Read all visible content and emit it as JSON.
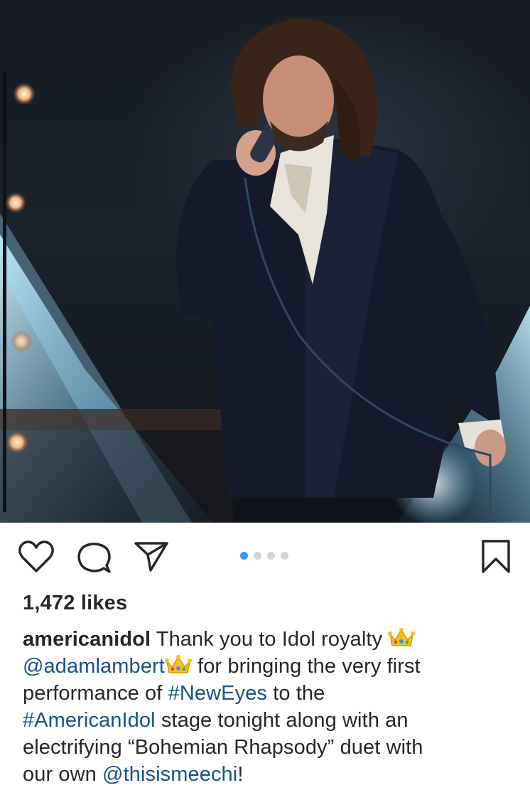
{
  "post": {
    "image_alt": "Performer in dark velvet suit singing into microphone on stage",
    "carousel": {
      "count": 4,
      "active_index": 0
    }
  },
  "actions": {
    "like_icon": "heart-icon",
    "comment_icon": "comment-icon",
    "share_icon": "paper-plane-icon",
    "save_icon": "bookmark-icon"
  },
  "likes": "1,472 likes",
  "caption": {
    "username": "americanidol",
    "line1_text": "Thank you to Idol royalty",
    "mention1": "@adamlambert",
    "line2_text": " for bringing the very first",
    "line3_text": "performance of ",
    "hashtag1": "#NewEyes",
    "line3_end": " to the",
    "hashtag2": "#AmericanIdol",
    "line4_text": " stage tonight along with an",
    "line5_text": "electrifying “Bohemian Rhapsody” duet with",
    "line6_text": "our own ",
    "mention2": "@thisismeechi",
    "line6_end": "!",
    "emoji": "crown-emoji"
  },
  "colors": {
    "link": "#1b4f8a",
    "active_dot": "#3897f0",
    "inactive_dot": "#d4d4d4",
    "text": "#262626"
  }
}
